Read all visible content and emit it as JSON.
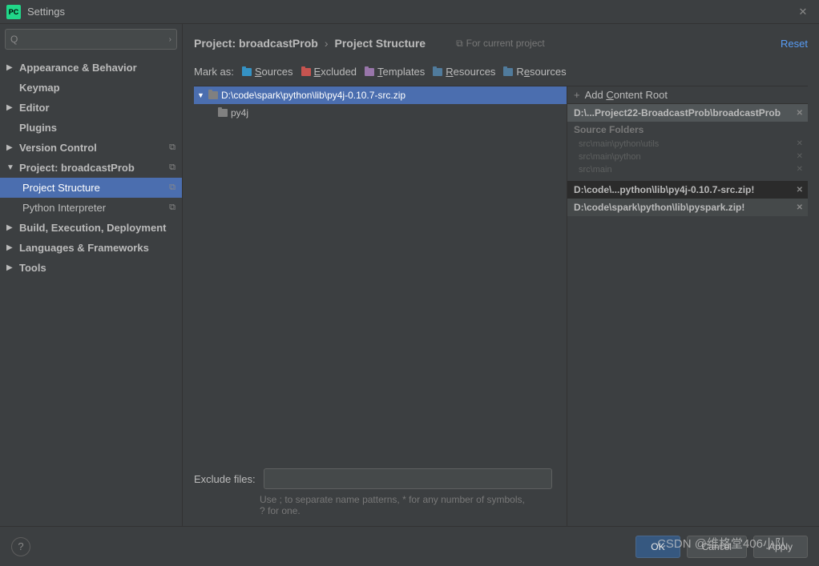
{
  "titlebar": {
    "icon_label": "PC",
    "title": "Settings"
  },
  "search": {
    "placeholder": ""
  },
  "sidebar": {
    "items": [
      {
        "label": "Appearance & Behavior",
        "arrow": "▶",
        "bold": true
      },
      {
        "label": "Keymap",
        "indent": true,
        "bold": true
      },
      {
        "label": "Editor",
        "arrow": "▶",
        "bold": true
      },
      {
        "label": "Plugins",
        "indent": true,
        "bold": true
      },
      {
        "label": "Version Control",
        "arrow": "▶",
        "bold": true,
        "copy": true
      },
      {
        "label": "Project: broadcastProb",
        "arrow": "▼",
        "bold": true,
        "copy": true
      },
      {
        "label": "Project Structure",
        "child": true,
        "selected": true,
        "copy": true
      },
      {
        "label": "Python Interpreter",
        "child": true,
        "copy": true
      },
      {
        "label": "Build, Execution, Deployment",
        "arrow": "▶",
        "bold": true
      },
      {
        "label": "Languages & Frameworks",
        "arrow": "▶",
        "bold": true
      },
      {
        "label": "Tools",
        "arrow": "▶",
        "bold": true
      }
    ]
  },
  "breadcrumb": {
    "item1": "Project: broadcastProb",
    "sep": "›",
    "item2": "Project Structure",
    "for_project": "For current project",
    "reset": "Reset"
  },
  "markas": {
    "label": "Mark as:",
    "sources": "Sources",
    "excluded": "Excluded",
    "templates": "Templates",
    "resources": "Resources",
    "resources2": "Resources"
  },
  "tree": {
    "root": "D:\\code\\spark\\python\\lib\\py4j-0.10.7-src.zip",
    "child": "py4j"
  },
  "right_panel": {
    "add_root": "Add Content Root",
    "entry1": "D:\\...Project22-BroadcastProb\\broadcastProb",
    "source_folders_head": "Source Folders",
    "sf1": "src\\main\\python\\utils",
    "sf2": "src\\main\\python",
    "sf3": "src\\main",
    "entry2": "D:\\code\\...python\\lib\\py4j-0.10.7-src.zip!",
    "entry3": "D:\\code\\spark\\python\\lib\\pyspark.zip!"
  },
  "exclude": {
    "label": "Exclude files:",
    "hint": "Use ; to separate name patterns, * for any number of symbols, ? for one."
  },
  "footer": {
    "ok": "OK",
    "cancel": "Cancel",
    "apply": "Apply"
  },
  "watermark": "CSDN @维格堂406小队"
}
